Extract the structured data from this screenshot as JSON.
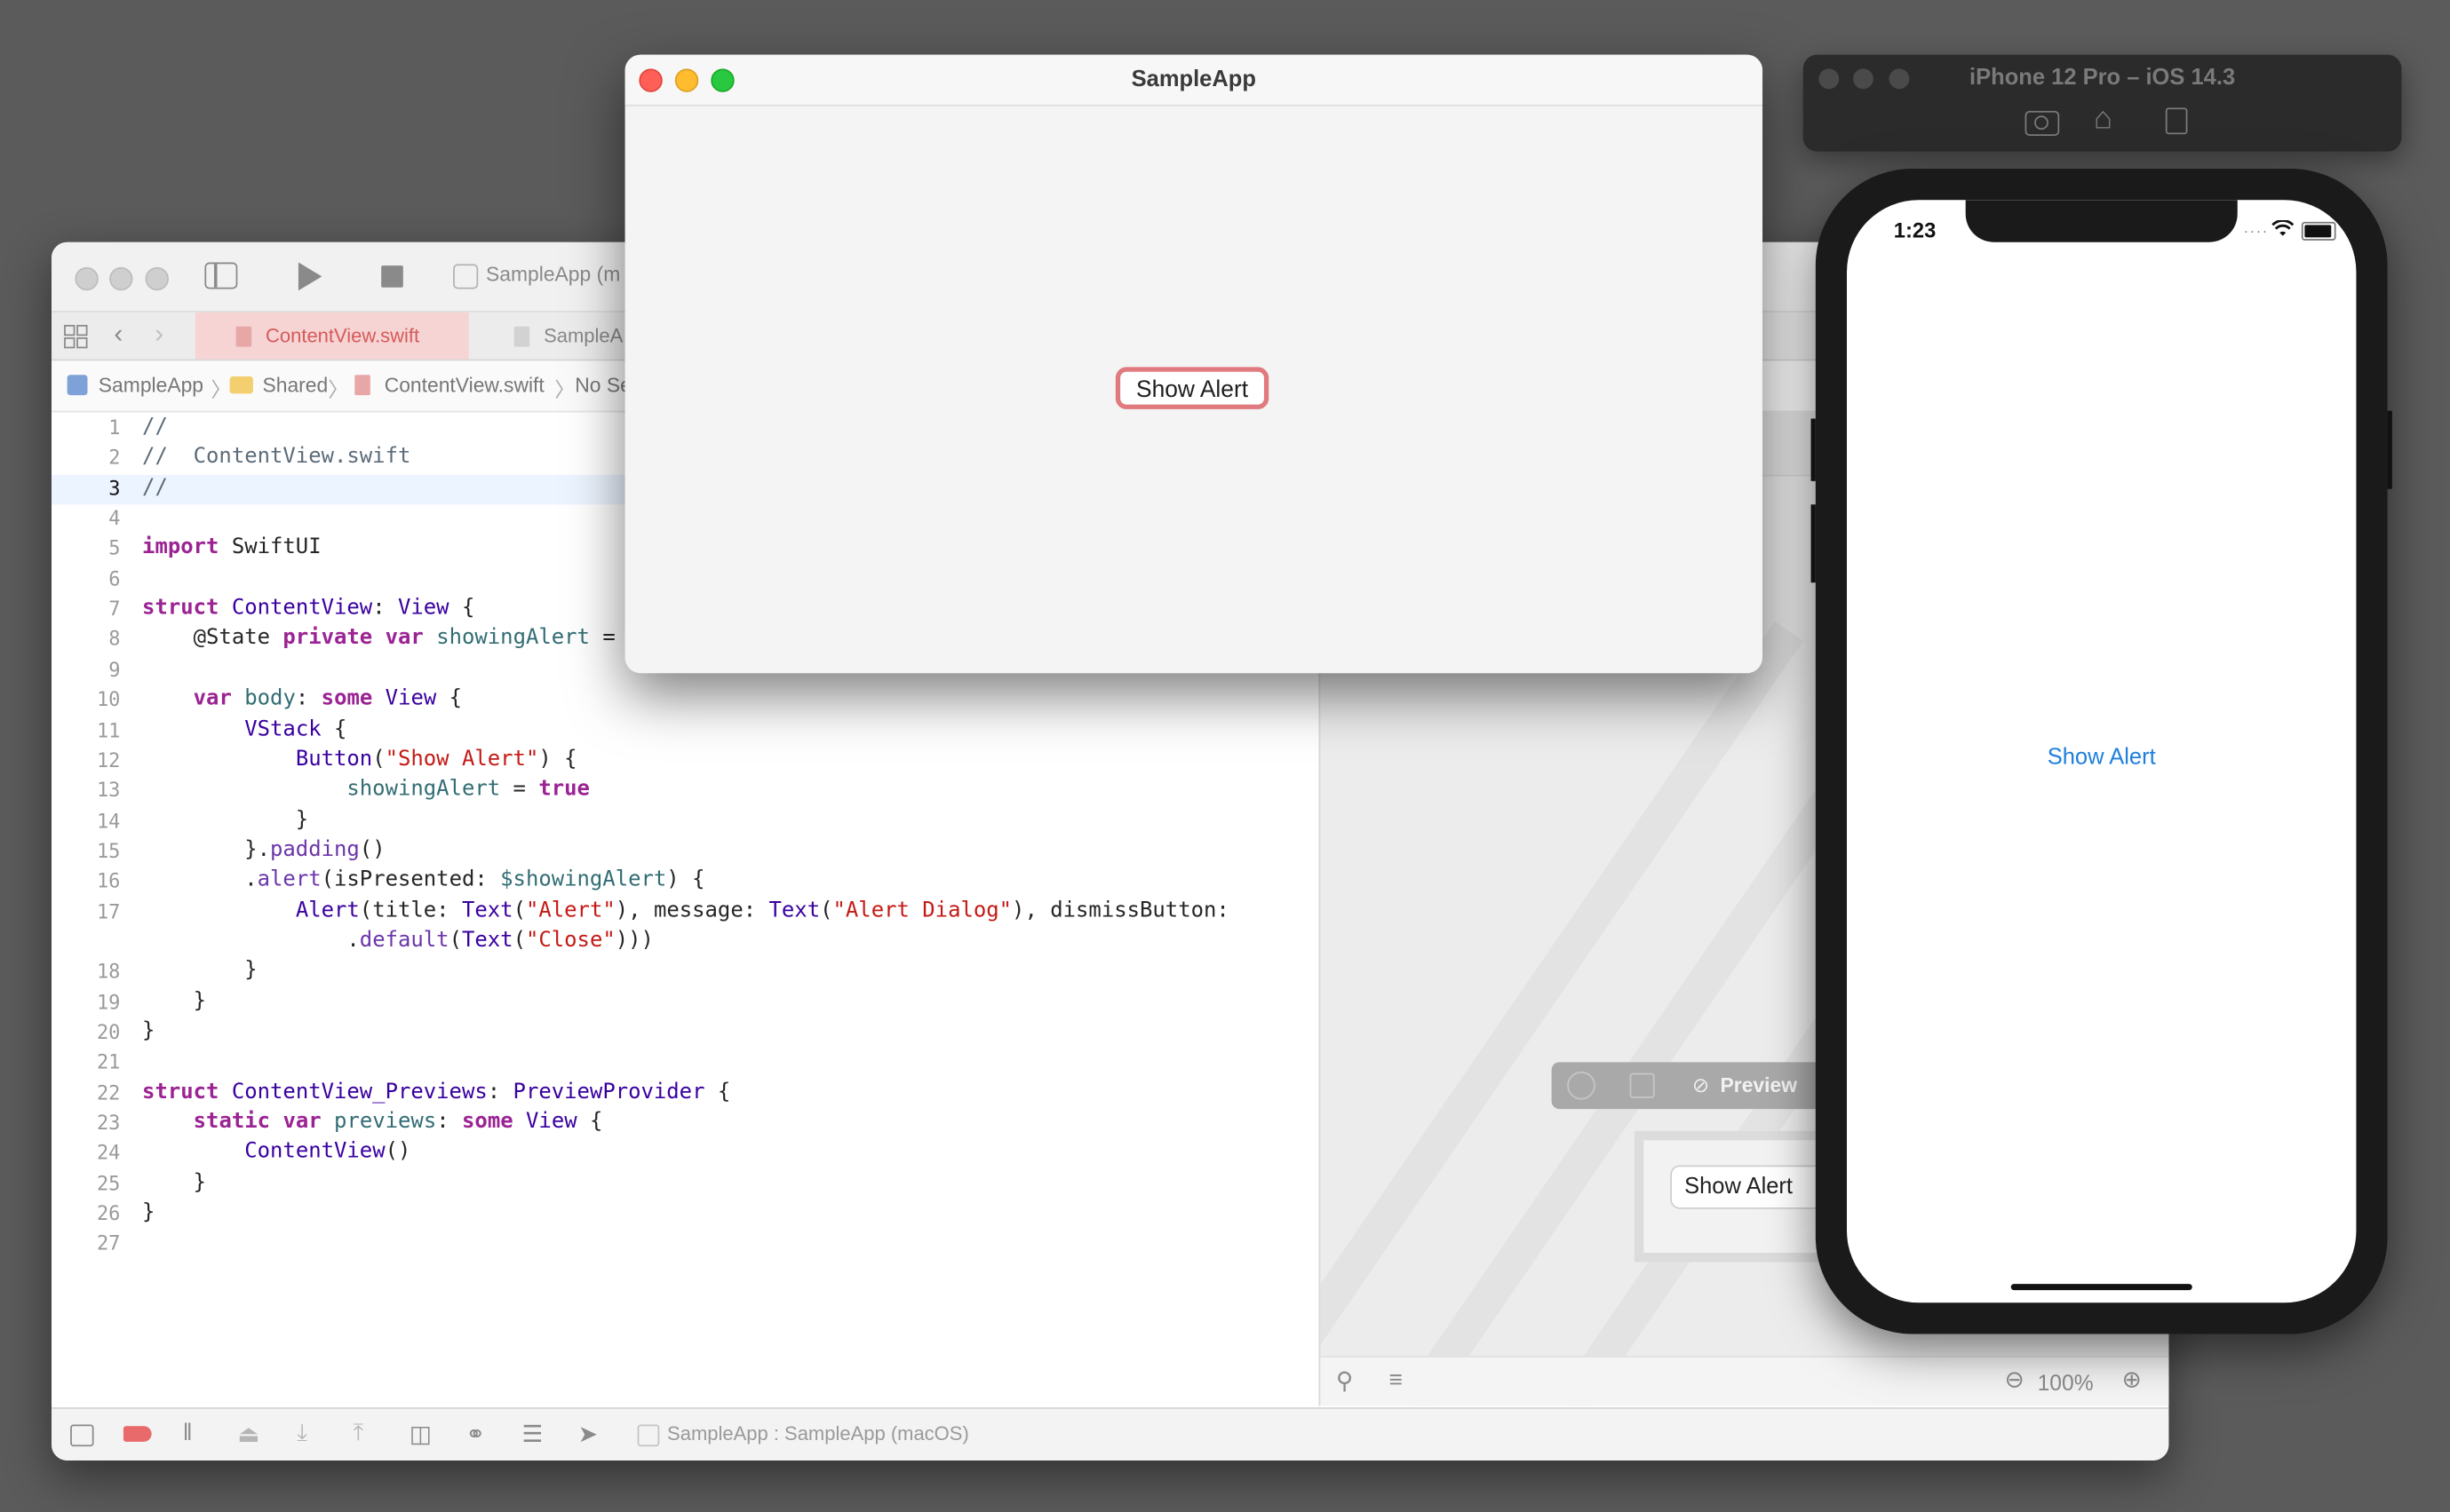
{
  "xcode": {
    "scheme_label": "SampleApp (m",
    "tabs": [
      {
        "label": "ContentView.swift",
        "active": true
      },
      {
        "label": "SampleA",
        "active": false
      }
    ],
    "breadcrumb": [
      "SampleApp",
      "Shared",
      "ContentView.swift",
      "No Se"
    ],
    "code_lines": [
      {
        "n": "1",
        "html": "<span class='cm'>//</span>"
      },
      {
        "n": "2",
        "html": "<span class='cm'>//  ContentView.swift</span>"
      },
      {
        "n": "3",
        "html": "<span class='cm'>//</span>"
      },
      {
        "n": "4",
        "html": ""
      },
      {
        "n": "5",
        "html": "<span class='kw'>import</span> SwiftUI"
      },
      {
        "n": "6",
        "html": ""
      },
      {
        "n": "7",
        "html": "<span class='kw'>struct</span> <span class='ty'>ContentView</span>: <span class='ty'>View</span> {"
      },
      {
        "n": "8",
        "html": "    @State <span class='kw'>private</span> <span class='kw'>var</span> <span class='pr'>showingAlert</span> ="
      },
      {
        "n": "9",
        "html": ""
      },
      {
        "n": "10",
        "html": "    <span class='kw'>var</span> <span class='pr'>body</span>: <span class='kw'>some</span> <span class='ty'>View</span> {"
      },
      {
        "n": "11",
        "html": "        <span class='ty'>VStack</span> {"
      },
      {
        "n": "12",
        "html": "            <span class='ty'>Button</span>(<span class='st'>\"Show Alert\"</span>) {"
      },
      {
        "n": "13",
        "html": "                <span class='pr'>showingAlert</span> = <span class='kw'>true</span>"
      },
      {
        "n": "14",
        "html": "            }"
      },
      {
        "n": "15",
        "html": "        }.<span class='fn'>padding</span>()"
      },
      {
        "n": "16",
        "html": "        .<span class='fn'>alert</span>(isPresented: <span class='pr'>$showingAlert</span>) {"
      },
      {
        "n": "17",
        "html": "            <span class='ty'>Alert</span>(title: <span class='ty'>Text</span>(<span class='st'>\"Alert\"</span>), message: <span class='ty'>Text</span>(<span class='st'>\"Alert Dialog\"</span>), dismissButton:"
      },
      {
        "n": "",
        "html": "                .<span class='fn'>default</span>(<span class='ty'>Text</span>(<span class='st'>\"Close\"</span>)))"
      },
      {
        "n": "18",
        "html": "        }"
      },
      {
        "n": "19",
        "html": "    }"
      },
      {
        "n": "20",
        "html": "}"
      },
      {
        "n": "21",
        "html": ""
      },
      {
        "n": "22",
        "html": "<span class='kw'>struct</span> <span class='ty'>ContentView_Previews</span>: <span class='ty'>PreviewProvider</span> {"
      },
      {
        "n": "23",
        "html": "    <span class='kw'>static</span> <span class='kw'>var</span> <span class='pr'>previews</span>: <span class='kw'>some</span> <span class='ty'>View</span> {"
      },
      {
        "n": "24",
        "html": "        <span class='ty'>ContentView</span>()"
      },
      {
        "n": "25",
        "html": "    }"
      },
      {
        "n": "26",
        "html": "}"
      },
      {
        "n": "27",
        "html": ""
      }
    ],
    "preview_label": "Preview",
    "preview_button_label": "Show Alert",
    "zoom_label": "100%",
    "debug_target": "SampleApp : SampleApp (macOS)"
  },
  "app_window": {
    "title": "SampleApp",
    "button_label": "Show Alert"
  },
  "simulator": {
    "title": "iPhone 12 Pro – iOS 14.3",
    "time": "1:23",
    "button_label": "Show Alert"
  },
  "colors": {
    "desktop": "#5b5b5b",
    "close": "#ff5f57",
    "minimize": "#febc2e",
    "zoom": "#28c840",
    "ios_tint": "#007aff",
    "focus_ring": "#e07a7e"
  }
}
